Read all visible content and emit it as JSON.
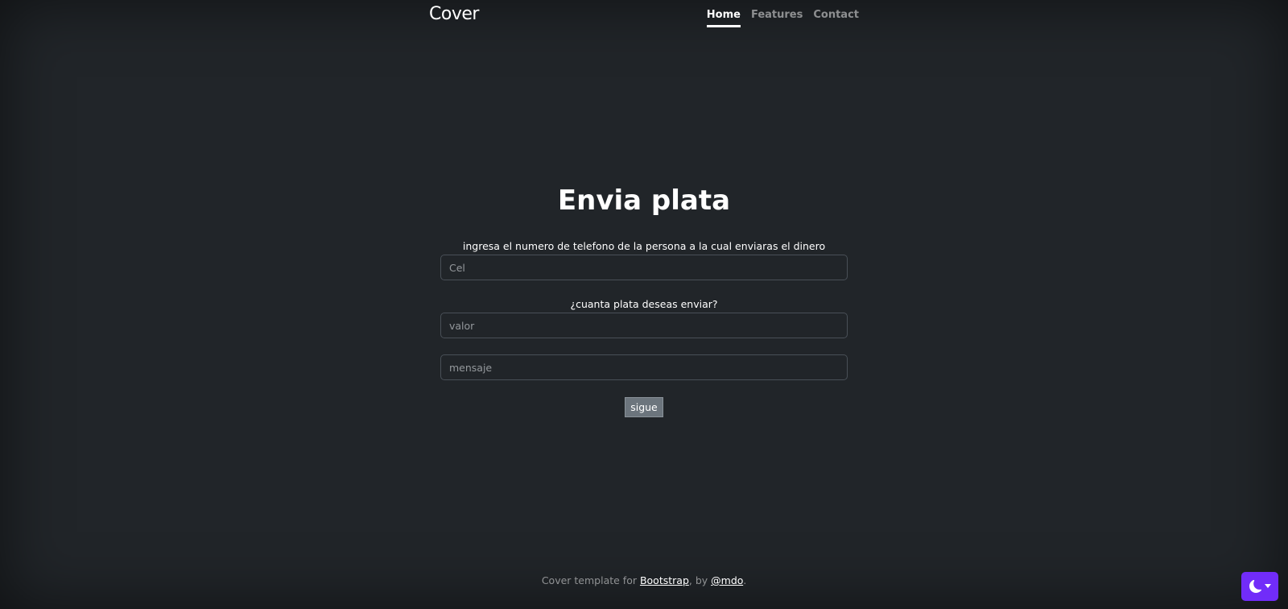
{
  "header": {
    "brand": "Cover",
    "nav": [
      {
        "label": "Home",
        "active": true
      },
      {
        "label": "Features",
        "active": false
      },
      {
        "label": "Contact",
        "active": false
      }
    ]
  },
  "main": {
    "title": "Envia plata",
    "phone_label": "ingresa el numero de telefono de la persona a la cual enviaras el dinero",
    "phone_placeholder": "Cel",
    "amount_label": "¿cuanta plata deseas enviar?",
    "amount_placeholder": "valor",
    "message_placeholder": "mensaje",
    "submit_label": "sigue"
  },
  "footer": {
    "prefix": "Cover template for ",
    "bootstrap_link": "Bootstrap",
    "middle": ", by ",
    "author_link": "@mdo",
    "suffix": "."
  },
  "theme_toggle": {
    "icon": "moon-icon",
    "accent": "#712cf9"
  },
  "colors": {
    "background": "#212529",
    "button": "#6c757d"
  }
}
